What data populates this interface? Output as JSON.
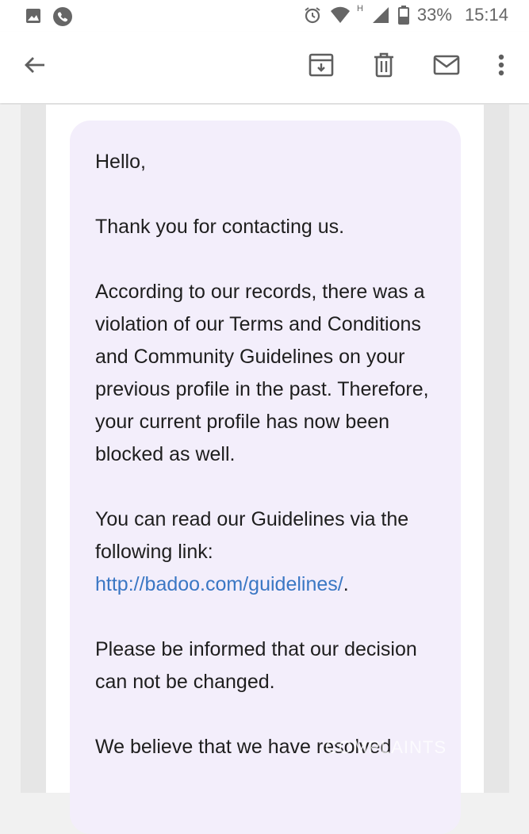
{
  "status_bar": {
    "network_type": "H",
    "battery": "33%",
    "time": "15:14"
  },
  "toolbar": {
    "back": "back",
    "actions": [
      "archive",
      "delete",
      "mark-unread",
      "more"
    ]
  },
  "email": {
    "greeting": "Hello,",
    "p1": "Thank you for contacting us.",
    "p2": "According to our records, there was a violation of our Terms and Conditions and Community Guidelines on your previous profile in the past. Therefore, your current profile has now been blocked as well.",
    "p3_prefix": "You can read our Guidelines via the following link: ",
    "p3_link": "http://badoo.com/guidelines/",
    "p3_suffix": ".",
    "p4": "Please be informed that our decision can not be changed.",
    "p5": "We believe that we have resolved"
  },
  "watermark": "COMPLAINTS",
  "colors": {
    "bubble": "#f3eefb",
    "link": "#3a77c4",
    "text": "#1e1e1e"
  }
}
